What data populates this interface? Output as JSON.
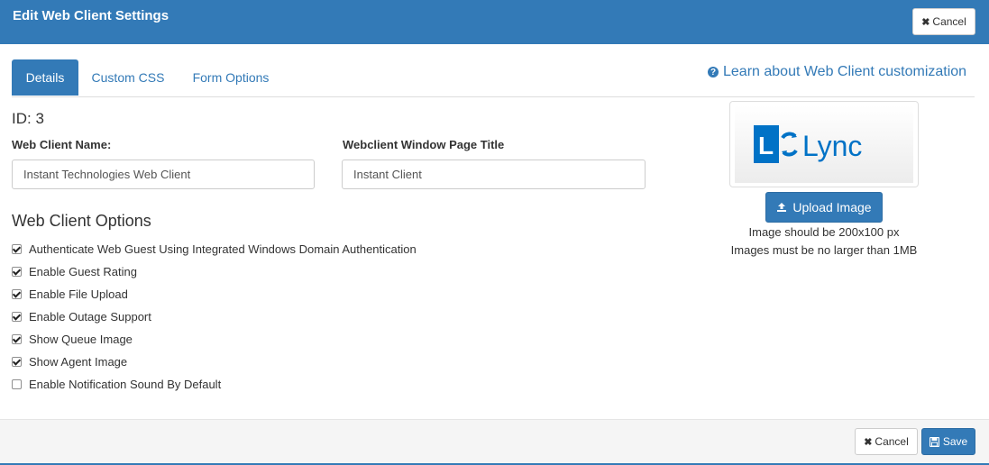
{
  "header": {
    "title": "Edit Web Client Settings",
    "cancel_label": "Cancel"
  },
  "tabs": [
    {
      "label": "Details",
      "active": true
    },
    {
      "label": "Custom CSS",
      "active": false
    },
    {
      "label": "Form Options",
      "active": false
    }
  ],
  "help_link": {
    "label": "Learn about Web Client customization",
    "icon": "question-circle-icon"
  },
  "details": {
    "id_label": "ID: 3",
    "name_label": "Web Client Name:",
    "name_value": "Instant Technologies Web Client",
    "title_label": "Webclient Window Page Title",
    "title_value": "Instant Client"
  },
  "options": {
    "heading": "Web Client Options",
    "items": [
      {
        "label": "Authenticate Web Guest Using Integrated Windows Domain Authentication",
        "checked": true
      },
      {
        "label": "Enable Guest Rating",
        "checked": true
      },
      {
        "label": "Enable File Upload",
        "checked": true
      },
      {
        "label": "Enable Outage Support",
        "checked": true
      },
      {
        "label": "Show Queue Image",
        "checked": true
      },
      {
        "label": "Show Agent Image",
        "checked": true
      },
      {
        "label": "Enable Notification Sound By Default",
        "checked": false
      }
    ]
  },
  "image_panel": {
    "logo_text": "Lync",
    "upload_label": "Upload Image",
    "note_size": "Image should be 200x100 px",
    "note_max": "Images must be no larger than 1MB"
  },
  "footer": {
    "cancel_label": "Cancel",
    "save_label": "Save"
  },
  "colors": {
    "primary": "#337ab7",
    "lync_blue": "#0072c6"
  }
}
